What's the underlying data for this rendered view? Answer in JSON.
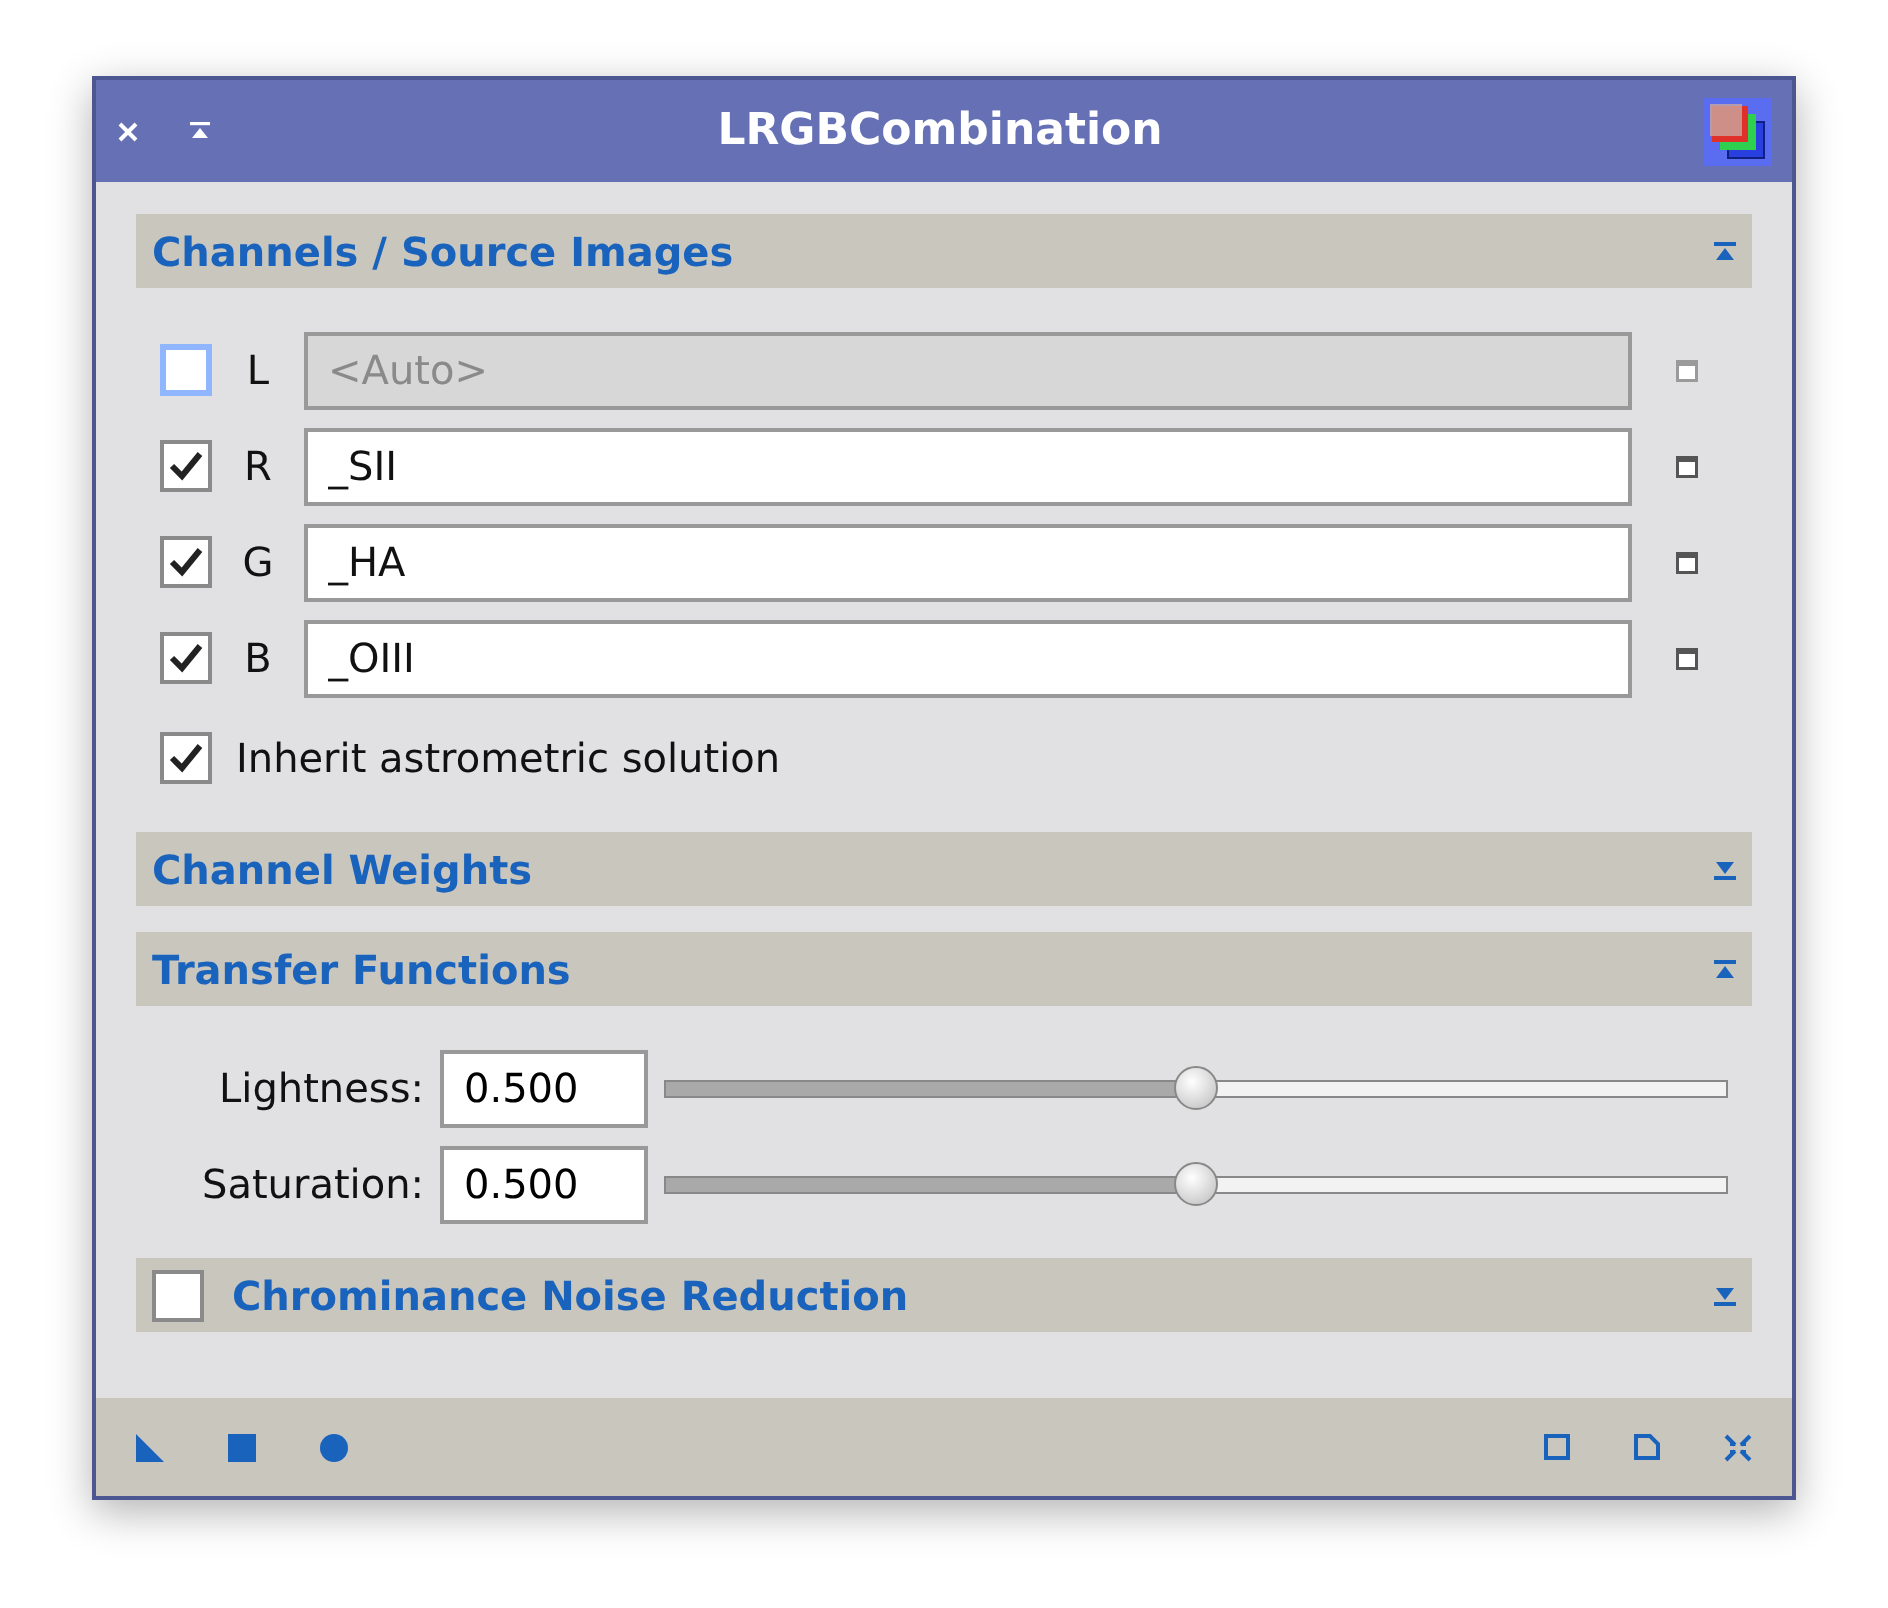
{
  "window": {
    "title": "LRGBCombination"
  },
  "sections": [
    {
      "kind": "channels",
      "title": "Channels / Source Images",
      "expanded": true,
      "channels": [
        {
          "label": "L",
          "checked": false,
          "focused": true,
          "disabled": true,
          "placeholder": "<Auto>"
        },
        {
          "label": "R",
          "checked": true,
          "focused": false,
          "disabled": false,
          "value": "_SII"
        },
        {
          "label": "G",
          "checked": true,
          "focused": false,
          "disabled": false,
          "value": "_HA"
        },
        {
          "label": "B",
          "checked": true,
          "focused": false,
          "disabled": false,
          "value": "_OIII"
        }
      ],
      "option": {
        "label": "Inherit astrometric solution",
        "checked": true
      }
    },
    {
      "kind": "plain",
      "title": "Channel Weights",
      "expanded": false
    },
    {
      "kind": "sliders",
      "title": "Transfer Functions",
      "expanded": true,
      "sliders": [
        {
          "label": "Lightness:",
          "value": "0.500",
          "level": 0.5
        },
        {
          "label": "Saturation:",
          "value": "0.500",
          "level": 0.5
        }
      ]
    },
    {
      "kind": "plain",
      "title": "Chrominance Noise Reduction",
      "expanded": false,
      "checked": false
    }
  ]
}
